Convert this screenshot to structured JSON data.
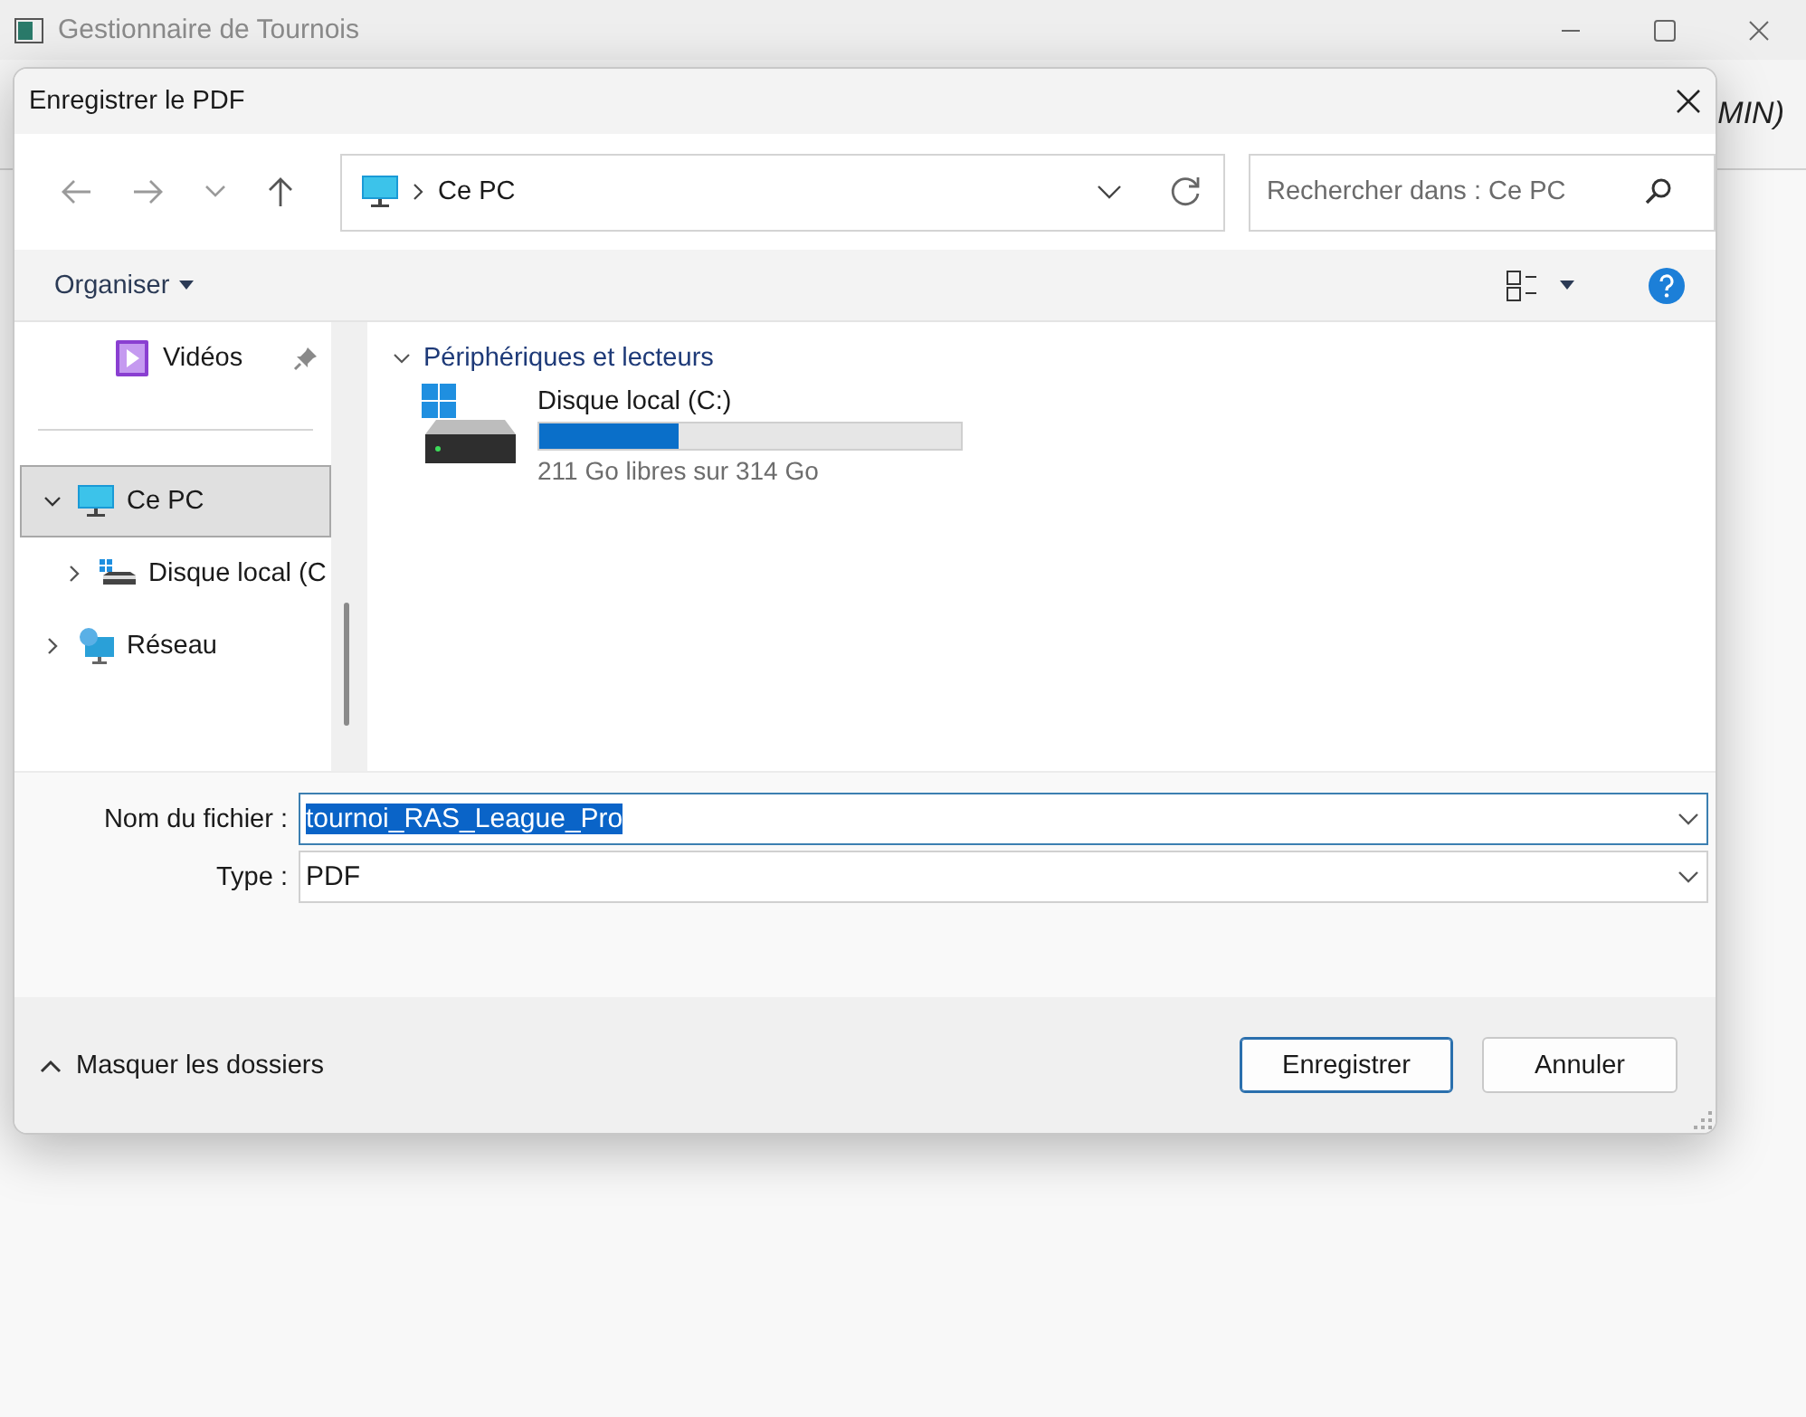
{
  "app": {
    "title": "Gestionnaire de Tournois",
    "partial_text": "MIN)"
  },
  "dialog": {
    "title": "Enregistrer le PDF",
    "address": {
      "segments": [
        "Ce PC"
      ]
    },
    "search": {
      "placeholder": "Rechercher dans : Ce PC"
    },
    "toolbar": {
      "organize": "Organiser"
    },
    "nav_pane": [
      {
        "label": "Vidéos",
        "kind": "pinned",
        "selected": false
      },
      {
        "label": "Ce PC",
        "kind": "tree",
        "selected": true,
        "expanded": true,
        "children": [
          {
            "label": "Disque local (C",
            "kind": "tree",
            "selected": false,
            "expanded": false
          }
        ]
      },
      {
        "label": "Réseau",
        "kind": "tree",
        "selected": false,
        "expanded": false
      }
    ],
    "group": {
      "title": "Périphériques et lecteurs",
      "expanded": true,
      "drives": [
        {
          "name": "Disque local (C:)",
          "level": 0.33,
          "reading": "211 Go libres sur 314 Go"
        }
      ]
    },
    "filename": {
      "label": "Nom du fichier :",
      "value": "tournoi_RAS_League_Pro",
      "text_selected": true
    },
    "type": {
      "label": "Type :",
      "value": "PDF"
    },
    "hide_folders": "Masquer les dossiers",
    "buttons": [
      {
        "label": "Enregistrer",
        "default": true
      },
      {
        "label": "Annuler",
        "default": false
      }
    ]
  }
}
